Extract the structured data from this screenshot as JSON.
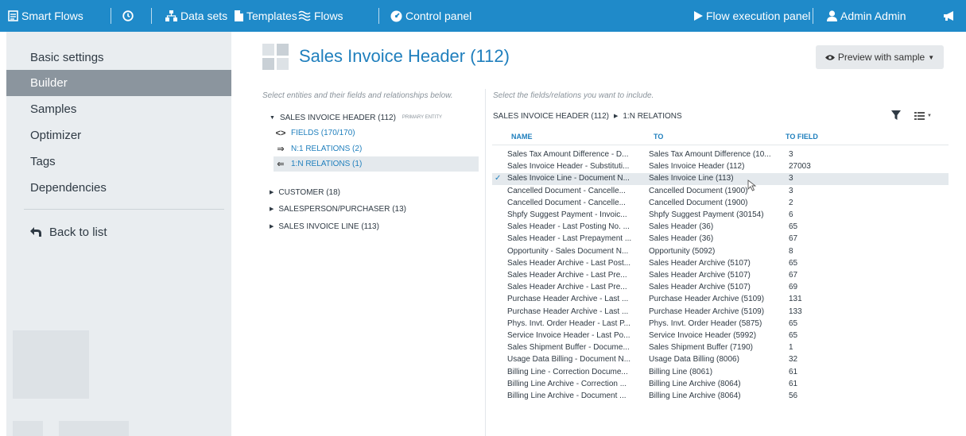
{
  "topbar": {
    "brand": "Smart Flows",
    "data_sets": "Data sets",
    "templates": "Templates",
    "flows": "Flows",
    "control_panel": "Control panel",
    "flow_execution": "Flow execution panel",
    "user": "Admin Admin",
    "bg_color": "#1f8ac9"
  },
  "sidebar": {
    "items": [
      {
        "label": "Basic settings"
      },
      {
        "label": "Builder"
      },
      {
        "label": "Samples"
      },
      {
        "label": "Optimizer"
      },
      {
        "label": "Tags"
      },
      {
        "label": "Dependencies"
      }
    ],
    "back": "Back to list",
    "active_color": "#8b959e"
  },
  "page": {
    "title": "Sales Invoice Header (112)",
    "preview_button": "Preview with sample"
  },
  "left": {
    "hint": "Select entities and their fields and relationships below.",
    "root": {
      "label": "SALES INVOICE HEADER (112)",
      "badge": "PRIMARY ENTITY"
    },
    "children": [
      {
        "icon": "code-icon",
        "label": "FIELDS (170/170)"
      },
      {
        "icon": "arrow-right-icon",
        "label": "N:1 RELATIONS (2)"
      },
      {
        "icon": "arrow-left-icon",
        "label": "1:N RELATIONS (1)"
      }
    ],
    "entities": [
      {
        "label": "CUSTOMER (18)"
      },
      {
        "label": "SALESPERSON/PURCHASER (13)"
      },
      {
        "label": "SALES INVOICE LINE (113)"
      }
    ]
  },
  "right": {
    "hint": "Select the fields/relations you want to include.",
    "crumb_root": "SALES INVOICE HEADER (112)",
    "crumb_leaf": "1:N RELATIONS",
    "columns": {
      "name": "NAME",
      "to": "TO",
      "to_field": "TO FIELD"
    },
    "rows": [
      {
        "check": "",
        "name": "Sales Tax Amount Difference - D...",
        "to": "Sales Tax Amount Difference (10...",
        "to_field": "3"
      },
      {
        "check": "",
        "name": "Sales Invoice Header - Substituti...",
        "to": "Sales Invoice Header (112)",
        "to_field": "27003"
      },
      {
        "check": "✓",
        "name": "Sales Invoice Line - Document N...",
        "to": "Sales Invoice Line (113)",
        "to_field": "3"
      },
      {
        "check": "",
        "name": "Cancelled Document - Cancelle...",
        "to": "Cancelled Document (1900)",
        "to_field": "3"
      },
      {
        "check": "",
        "name": "Cancelled Document - Cancelle...",
        "to": "Cancelled Document (1900)",
        "to_field": "2"
      },
      {
        "check": "",
        "name": "Shpfy Suggest Payment - Invoic...",
        "to": "Shpfy Suggest Payment (30154)",
        "to_field": "6"
      },
      {
        "check": "",
        "name": "Sales Header - Last Posting No. ...",
        "to": "Sales Header (36)",
        "to_field": "65"
      },
      {
        "check": "",
        "name": "Sales Header - Last Prepayment ...",
        "to": "Sales Header (36)",
        "to_field": "67"
      },
      {
        "check": "",
        "name": "Opportunity - Sales Document N...",
        "to": "Opportunity (5092)",
        "to_field": "8"
      },
      {
        "check": "",
        "name": "Sales Header Archive - Last Post...",
        "to": "Sales Header Archive (5107)",
        "to_field": "65"
      },
      {
        "check": "",
        "name": "Sales Header Archive - Last Pre...",
        "to": "Sales Header Archive (5107)",
        "to_field": "67"
      },
      {
        "check": "",
        "name": "Sales Header Archive - Last Pre...",
        "to": "Sales Header Archive (5107)",
        "to_field": "69"
      },
      {
        "check": "",
        "name": "Purchase Header Archive - Last ...",
        "to": "Purchase Header Archive (5109)",
        "to_field": "131"
      },
      {
        "check": "",
        "name": "Purchase Header Archive - Last ...",
        "to": "Purchase Header Archive (5109)",
        "to_field": "133"
      },
      {
        "check": "",
        "name": "Phys. Invt. Order Header - Last P...",
        "to": "Phys. Invt. Order Header (5875)",
        "to_field": "65"
      },
      {
        "check": "",
        "name": "Service Invoice Header - Last Po...",
        "to": "Service Invoice Header (5992)",
        "to_field": "65"
      },
      {
        "check": "",
        "name": "Sales Shipment Buffer - Docume...",
        "to": "Sales Shipment Buffer (7190)",
        "to_field": "1"
      },
      {
        "check": "",
        "name": "Usage Data Billing - Document N...",
        "to": "Usage Data Billing (8006)",
        "to_field": "32"
      },
      {
        "check": "",
        "name": "Billing Line - Correction Docume...",
        "to": "Billing Line (8061)",
        "to_field": "61"
      },
      {
        "check": "",
        "name": "Billing Line Archive - Correction ...",
        "to": "Billing Line Archive (8064)",
        "to_field": "61"
      },
      {
        "check": "",
        "name": "Billing Line Archive - Document ...",
        "to": "Billing Line Archive (8064)",
        "to_field": "56"
      }
    ]
  }
}
